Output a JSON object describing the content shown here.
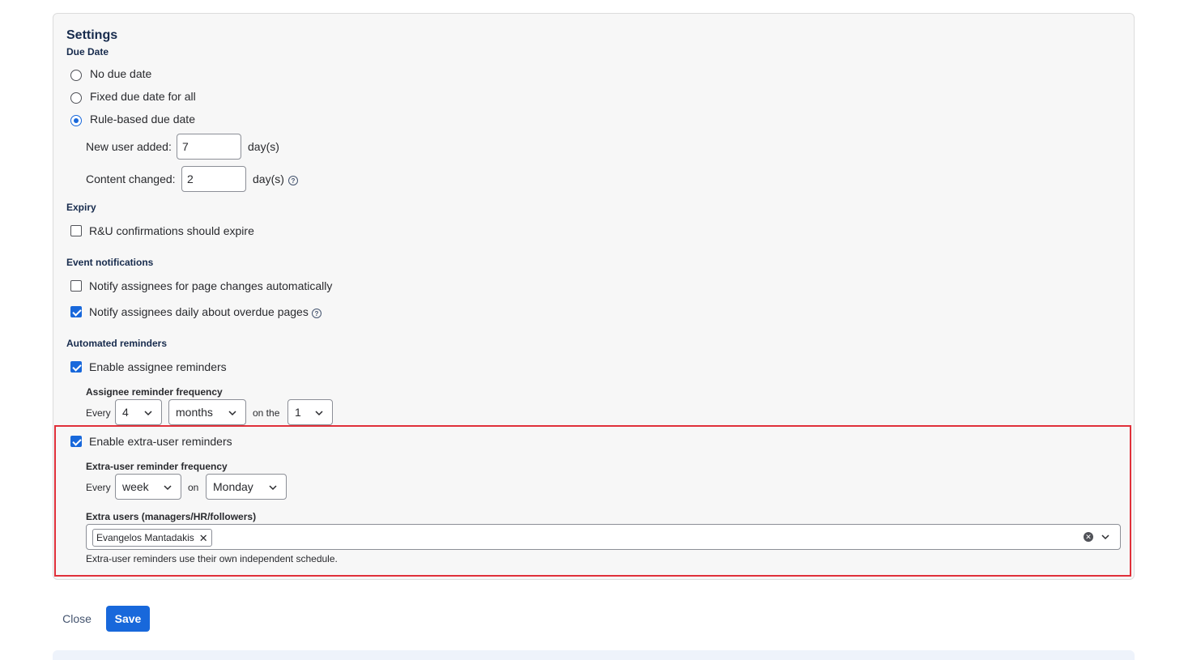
{
  "settings": {
    "title": "Settings",
    "due_date": {
      "heading": "Due Date",
      "options": [
        "No due date",
        "Fixed due date for all",
        "Rule-based due date"
      ],
      "selected_index": 2,
      "new_user_label": "New user added:",
      "new_user_value": "7",
      "content_changed_label": "Content changed:",
      "content_changed_value": "2",
      "unit": "day(s)"
    },
    "expiry": {
      "heading": "Expiry",
      "confirm_expire_label": "R&U confirmations should expire",
      "confirm_expire_checked": false
    },
    "event_notifications": {
      "heading": "Event notifications",
      "page_changes_label": "Notify assignees for page changes automatically",
      "page_changes_checked": false,
      "overdue_label": "Notify assignees daily about overdue pages",
      "overdue_checked": true
    },
    "automated_reminders": {
      "heading": "Automated reminders",
      "assignee_label": "Enable assignee reminders",
      "assignee_checked": true,
      "assignee_frequency_label": "Assignee reminder frequency",
      "every_label": "Every",
      "assignee_every_value": "4",
      "assignee_unit_value": "months",
      "on_the_label": "on the",
      "assignee_day_value": "1",
      "extra_label": "Enable extra-user reminders",
      "extra_checked": true,
      "extra_frequency_label": "Extra-user reminder frequency",
      "extra_every_value": "week",
      "on_label": "on",
      "extra_day_value": "Monday",
      "extra_users_label": "Extra users (managers/HR/followers)",
      "extra_users": [
        "Evangelos Mantadakis"
      ],
      "extra_help_text": "Extra-user reminders use their own independent schedule."
    }
  },
  "footer": {
    "close_label": "Close",
    "save_label": "Save"
  },
  "icons": {
    "help": "question-circle-icon",
    "chevron": "chevron-down-icon",
    "clear": "clear-icon",
    "remove": "close-icon"
  },
  "colors": {
    "accent": "#1868db",
    "highlight_border": "#e0303a"
  }
}
